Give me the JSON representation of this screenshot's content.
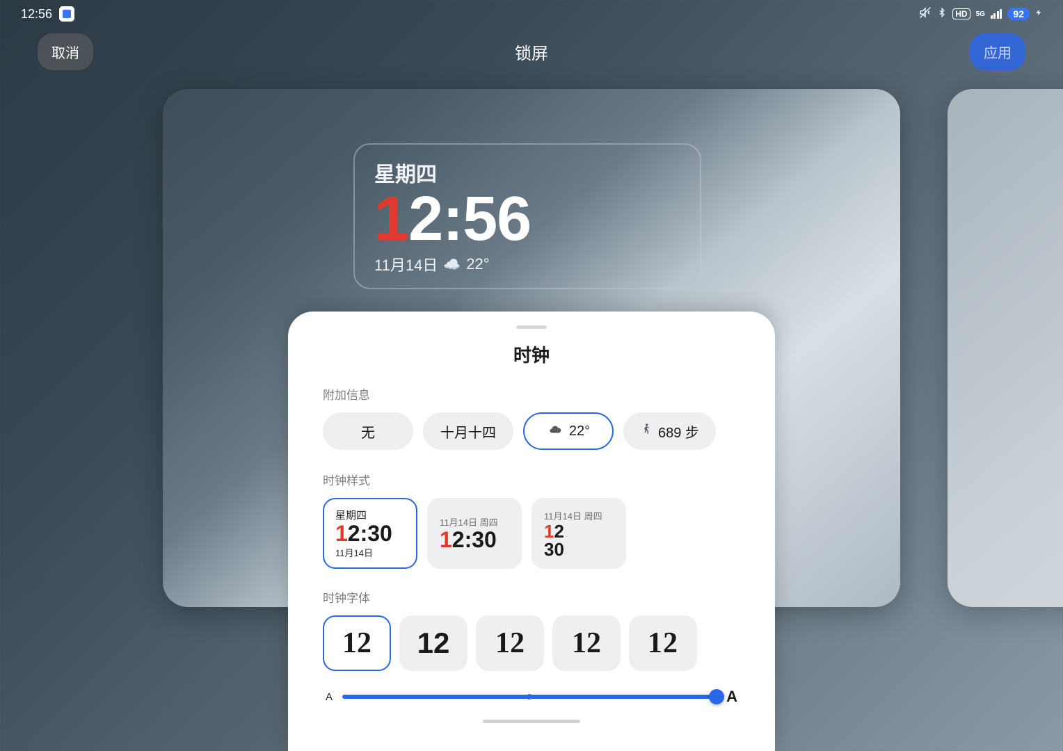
{
  "status_bar": {
    "time": "12:56",
    "battery": "92"
  },
  "nav": {
    "cancel": "取消",
    "title": "锁屏",
    "apply": "应用"
  },
  "clock_widget": {
    "day": "星期四",
    "time_accent": "1",
    "time_rest": "2:56",
    "date": "11月14日",
    "temp": "22°"
  },
  "sheet": {
    "title": "时钟",
    "sections": {
      "extra_info": {
        "label": "附加信息",
        "options": {
          "none": "无",
          "lunar": "十月十四",
          "weather": "22°",
          "steps": "689 步"
        },
        "selected": "weather"
      },
      "clock_style": {
        "label": "时钟样式",
        "options": [
          {
            "day": "星期四",
            "time_accent": "1",
            "time_rest": "2:30",
            "date": "11月14日"
          },
          {
            "top": "11月14日 周四",
            "time_accent": "1",
            "time_rest": "2:30"
          },
          {
            "top": "11月14日 周四",
            "line1_accent": "1",
            "line1_rest": "2",
            "line2": "30"
          }
        ],
        "selected": 0
      },
      "clock_font": {
        "label": "时钟字体",
        "sample": "12",
        "count": 5,
        "selected": 0
      },
      "slider": {
        "small": "A",
        "big": "A"
      }
    }
  }
}
